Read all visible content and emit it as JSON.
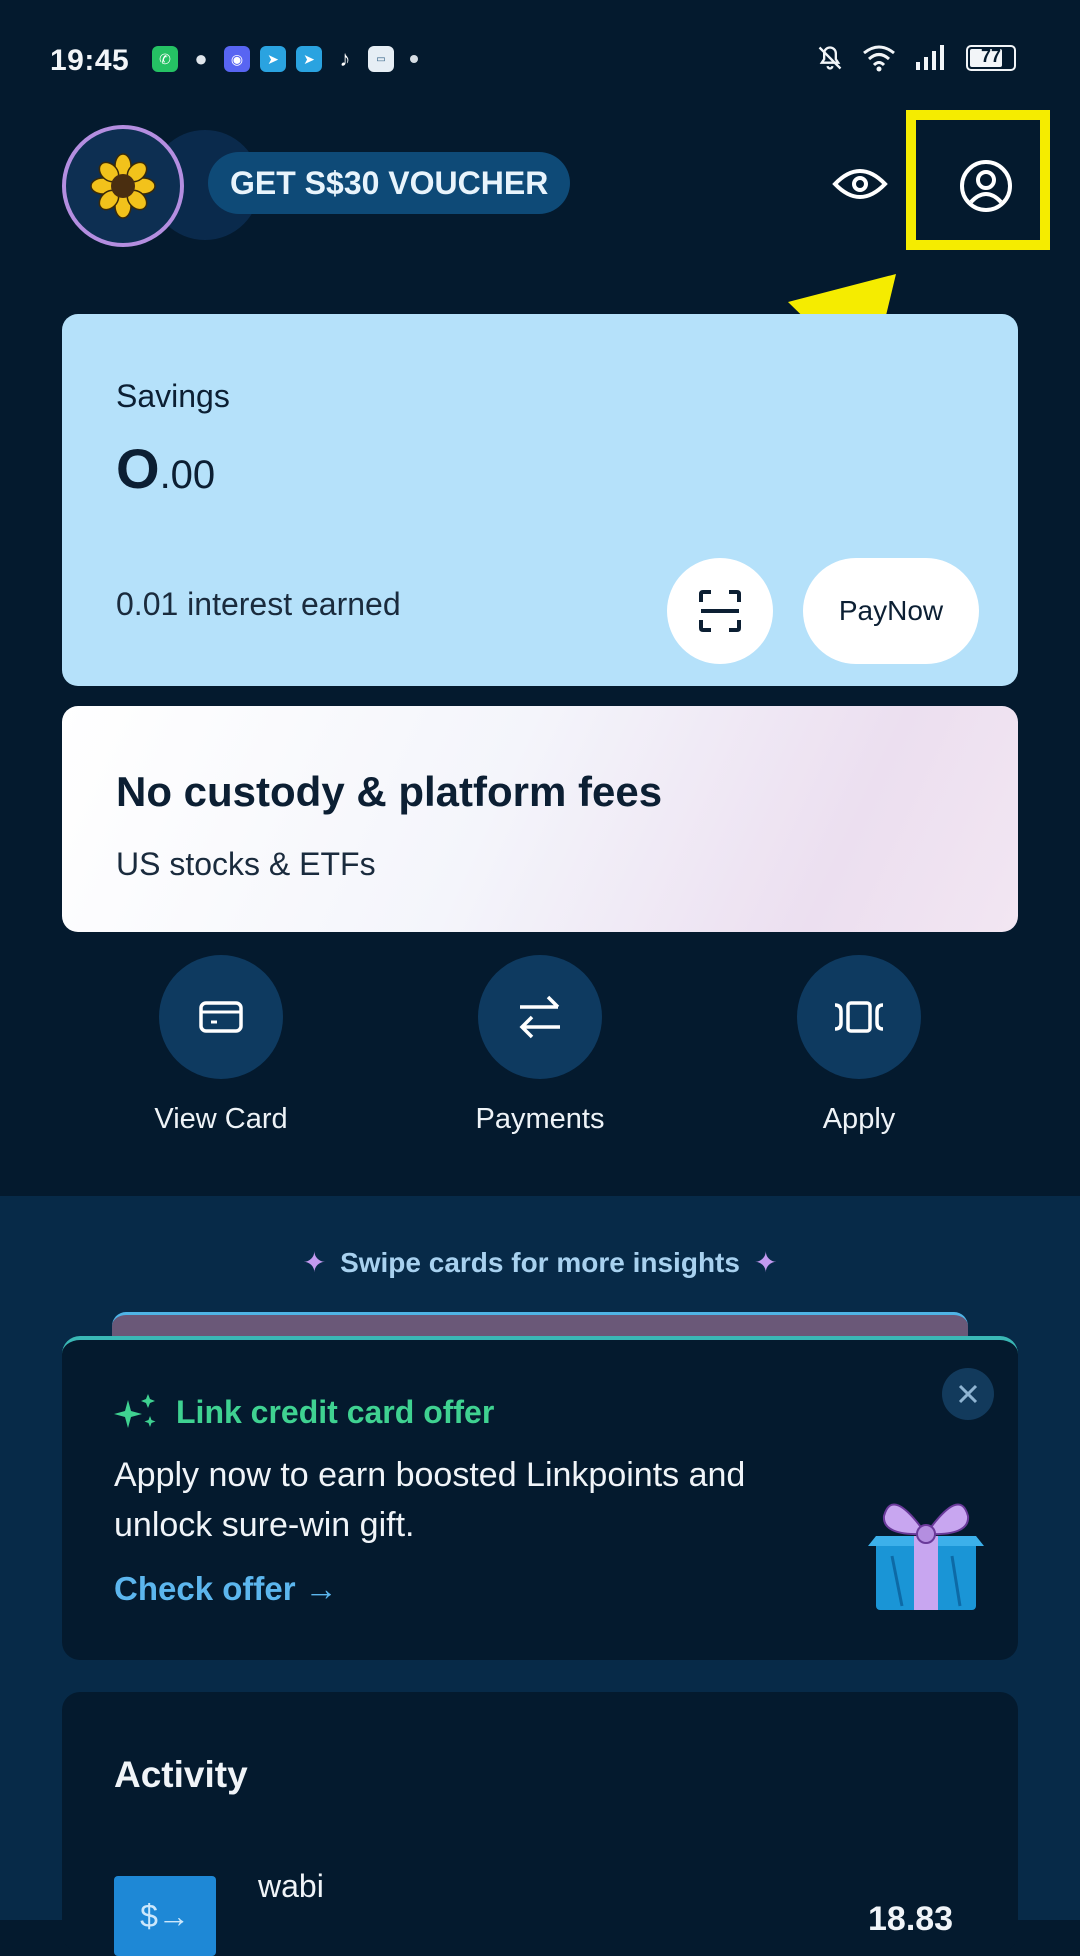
{
  "status_bar": {
    "time": "19:45",
    "notification_icons": [
      "whatsapp-icon",
      "message-icon",
      "discord-icon",
      "telegram-icon",
      "telegram-icon",
      "tiktok-icon",
      "app-icon"
    ],
    "battery": "77"
  },
  "header": {
    "voucher_label": "GET S$30 VOUCHER",
    "eye_icon": "eye-icon",
    "profile_icon": "profile-icon"
  },
  "savings": {
    "label": "Savings",
    "amount_whole": "O",
    "amount_decimal": ".00",
    "interest": "0.01 interest earned",
    "paynow_label": "PayNow"
  },
  "promo": {
    "title": "No custody & platform fees",
    "subtitle": "US stocks & ETFs"
  },
  "quick_actions": [
    {
      "label": "View Card",
      "icon": "card-icon"
    },
    {
      "label": "Payments",
      "icon": "transfer-arrows-icon"
    },
    {
      "label": "Apply",
      "icon": "cards-stack-icon"
    }
  ],
  "insights": {
    "text": "Swipe cards for more insights"
  },
  "offer": {
    "title": "Link credit card offer",
    "body": "Apply now to earn boosted Linkpoints and unlock sure-win gift.",
    "cta": "Check offer",
    "cta_arrow": "→"
  },
  "activity": {
    "title": "Activity",
    "transactions": [
      {
        "name": "wabi",
        "amount": "18.83",
        "icon_glyph": "$→"
      }
    ]
  },
  "colors": {
    "background": "#041a2e",
    "savings_card": "#b5e1fa",
    "highlight": "#f5ec00",
    "offer_accent": "#3fd291",
    "link": "#5cb6ee"
  }
}
